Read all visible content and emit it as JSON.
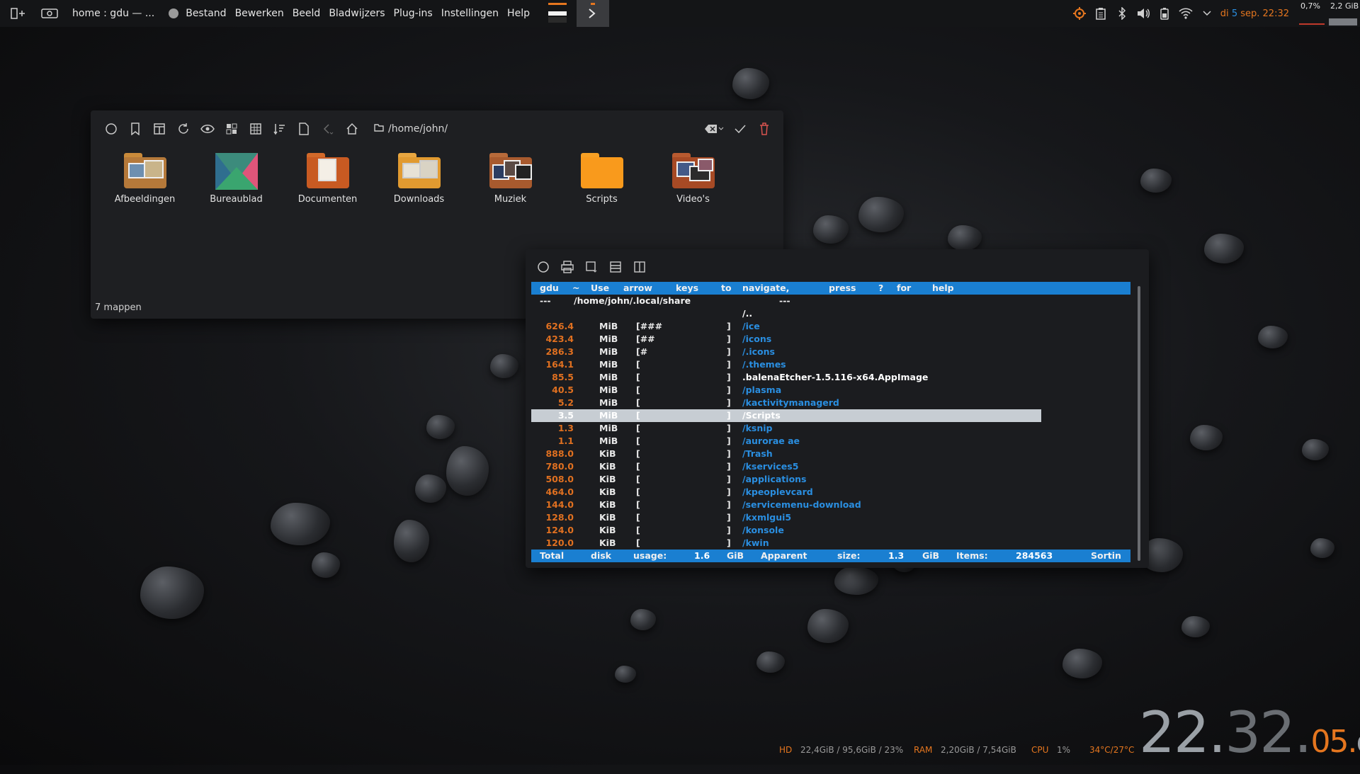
{
  "panel": {
    "window_title": "home : gdu — ...",
    "menu": [
      "Bestand",
      "Bewerken",
      "Beeld",
      "Bladwijzers",
      "Plug-ins",
      "Instellingen",
      "Help"
    ],
    "clock_day": "di",
    "clock_daynum": "5",
    "clock_month": "sep.",
    "clock_time": "22:32",
    "cpu_pct": "0,7%",
    "mem": "2,2 GiB"
  },
  "file_manager": {
    "path": "/home/john/",
    "folders": [
      {
        "label": "Afbeeldingen",
        "icon": "pictures-folder-icon"
      },
      {
        "label": "Bureaublad",
        "icon": "desktop-folder-icon"
      },
      {
        "label": "Documenten",
        "icon": "documents-folder-icon"
      },
      {
        "label": "Downloads",
        "icon": "downloads-folder-icon"
      },
      {
        "label": "Muziek",
        "icon": "music-folder-icon"
      },
      {
        "label": "Scripts",
        "icon": "scripts-folder-icon"
      },
      {
        "label": "Video's",
        "icon": "videos-folder-icon"
      }
    ],
    "status": "7 mappen"
  },
  "terminal": {
    "header": [
      "gdu",
      "~",
      "Use",
      "arrow",
      "keys",
      "to",
      "navigate,",
      "press",
      "?",
      "for",
      "help"
    ],
    "path_prefix": "---",
    "path": "/home/john/.local/share",
    "path_suffix": "---",
    "parent": "/..",
    "rows": [
      {
        "size": "626.4",
        "unit": "MiB",
        "bar": "[###",
        "end": "]",
        "name": "/ice"
      },
      {
        "size": "423.4",
        "unit": "MiB",
        "bar": "[##",
        "end": "]",
        "name": "/icons"
      },
      {
        "size": "286.3",
        "unit": "MiB",
        "bar": "[#",
        "end": "]",
        "name": "/.icons"
      },
      {
        "size": "164.1",
        "unit": "MiB",
        "bar": "[",
        "end": "]",
        "name": "/.themes"
      },
      {
        "size": "85.5",
        "unit": "MiB",
        "bar": "[",
        "end": "]",
        "name": ".balenaEtcher-1.5.116-x64.AppImage"
      },
      {
        "size": "40.5",
        "unit": "MiB",
        "bar": "[",
        "end": "]",
        "name": "/plasma"
      },
      {
        "size": "5.2",
        "unit": "MiB",
        "bar": "[",
        "end": "]",
        "name": "/kactivitymanagerd"
      },
      {
        "size": "3.5",
        "unit": "MiB",
        "bar": "[",
        "end": "]",
        "name": "/Scripts"
      },
      {
        "size": "1.3",
        "unit": "MiB",
        "bar": "[",
        "end": "]",
        "name": "/ksnip"
      },
      {
        "size": "1.1",
        "unit": "MiB",
        "bar": "[",
        "end": "]",
        "name": "/aurorae   ae"
      },
      {
        "size": "888.0",
        "unit": "KiB",
        "bar": "[",
        "end": "]",
        "name": "/Trash"
      },
      {
        "size": "780.0",
        "unit": "KiB",
        "bar": "[",
        "end": "]",
        "name": "/kservices5"
      },
      {
        "size": "508.0",
        "unit": "KiB",
        "bar": "[",
        "end": "]",
        "name": "/applications"
      },
      {
        "size": "464.0",
        "unit": "KiB",
        "bar": "[",
        "end": "]",
        "name": "/kpeoplevcard"
      },
      {
        "size": "144.0",
        "unit": "KiB",
        "bar": "[",
        "end": "]",
        "name": "/servicemenu-download"
      },
      {
        "size": "128.0",
        "unit": "KiB",
        "bar": "[",
        "end": "]",
        "name": "/kxmlgui5"
      },
      {
        "size": "124.0",
        "unit": "KiB",
        "bar": "[",
        "end": "]",
        "name": "/konsole"
      },
      {
        "size": "120.0",
        "unit": "KiB",
        "bar": "[",
        "end": "]",
        "name": "/kwin"
      }
    ],
    "footer": [
      "Total",
      "disk",
      "usage:",
      "1.6",
      "GiB",
      "Apparent",
      "size:",
      "1.3",
      "GiB",
      "Items:",
      "284563",
      "Sortin"
    ]
  },
  "stats": {
    "hd_label": "HD",
    "hd_value": "22,4GiB / 95,6GiB / 23%",
    "ram_label": "RAM",
    "ram_value": "2,20GiB / 7,54GiB",
    "cpu_label": "CPU",
    "cpu_value": "1%",
    "temp": "34°C/27°C"
  },
  "big_clock": {
    "hh": "22",
    "sep1": ".",
    "mm": "32",
    "sep2": ".",
    "ss": "05",
    "sep3": ".",
    "day": "di"
  },
  "colors": {
    "accent_blue": "#1a7fd1",
    "accent_orange": "#e5761f",
    "link_blue": "#2a8ee0"
  }
}
